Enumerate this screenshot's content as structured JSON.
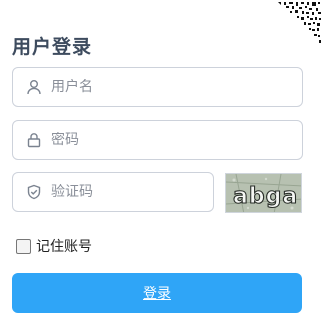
{
  "login": {
    "title": "用户登录",
    "username": {
      "placeholder": "用户名",
      "value": ""
    },
    "password": {
      "placeholder": "密码",
      "value": ""
    },
    "captcha": {
      "placeholder": "验证码",
      "value": "",
      "image_text": "abga"
    },
    "remember_label": "记住账号",
    "remember_checked": false,
    "submit_label": "登录"
  },
  "colors": {
    "title": "#3d4b5e",
    "border": "#cdd2db",
    "button": "#2fa5f7",
    "button_text": "#ffffff"
  },
  "icons": {
    "username": "user-icon",
    "password": "lock-icon",
    "captcha": "shield-check-icon",
    "corner": "qr-code-icon"
  }
}
